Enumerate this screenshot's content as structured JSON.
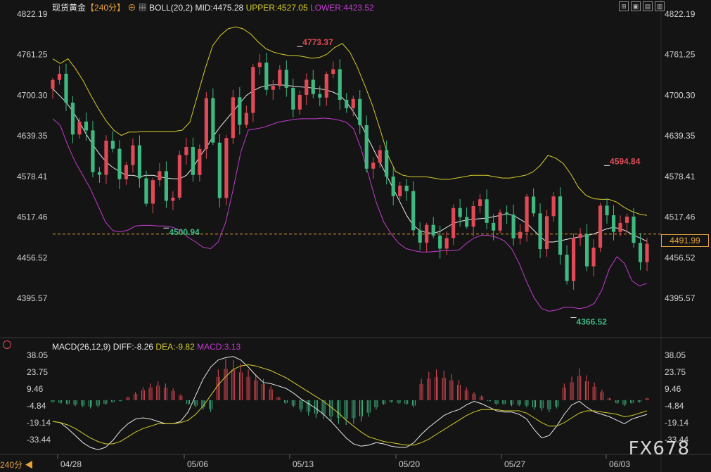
{
  "header": {
    "symbol": "现货黄金",
    "period": "【240分】",
    "indicator_icon": "boll-icon",
    "boll_label": "BOLL(20,2)",
    "mid_label": "MID:4475.28",
    "upper_label": "UPPER:4527.05",
    "lower_label": "LOWER:4423.52"
  },
  "toolbar": [
    "⊞",
    "▣",
    "▤",
    "▥"
  ],
  "macd_header": {
    "label": "MACD(26,12,9)",
    "diff_label": "DIFF:-8.26",
    "dea_label": "DEA:-9.82",
    "macd_label": "MACD:3.13"
  },
  "ticker_label": "240分",
  "current_price": "4491.99",
  "watermark": "FX678",
  "colors": {
    "background": "#141414",
    "up": "#e04a56",
    "down": "#3fb982",
    "mid": "#e8e8e8",
    "upper": "#d4cc2a",
    "lower": "#c23bd0",
    "price_line": "#e6a23c"
  },
  "chart_data": [
    {
      "type": "candlestick",
      "title": "现货黄金 240分",
      "y_ticks": [
        "4822.19",
        "4761.25",
        "4700.30",
        "4639.35",
        "4578.41",
        "4517.46",
        "4456.52",
        "4395.57"
      ],
      "ylim": [
        4360,
        4830
      ],
      "x_ticks": [
        "04/28",
        "05/06",
        "05/13",
        "05/20",
        "05/27",
        "06/03"
      ],
      "annotations": [
        {
          "label": "4773.37",
          "bar": 37,
          "price": 4773.37,
          "kind": "high"
        },
        {
          "label": "4500.94",
          "bar": 17,
          "price": 4500.94,
          "kind": "low"
        },
        {
          "label": "4594.84",
          "bar": 83,
          "price": 4594.84,
          "kind": "high"
        },
        {
          "label": "4366.52",
          "bar": 78,
          "price": 4366.52,
          "kind": "low"
        }
      ],
      "series": [
        {
          "name": "MID",
          "values": [
            4710,
            4700,
            4690,
            4676,
            4660,
            4642,
            4626,
            4612,
            4600,
            4592,
            4586,
            4580,
            4580,
            4578,
            4580,
            4580,
            4578,
            4576,
            4575,
            4575,
            4580,
            4592,
            4608,
            4622,
            4638,
            4652,
            4664,
            4676,
            4688,
            4700,
            4707,
            4712,
            4715,
            4716,
            4716,
            4715,
            4714,
            4713,
            4712,
            4711,
            4710,
            4708,
            4705,
            4700,
            4690,
            4676,
            4660,
            4640,
            4620,
            4600,
            4580,
            4560,
            4540,
            4520,
            4505,
            4497,
            4494,
            4493,
            4496,
            4502,
            4508,
            4511,
            4513,
            4514,
            4515,
            4516,
            4518,
            4520,
            4522,
            4520,
            4514,
            4508,
            4498,
            4488,
            4480,
            4480,
            4482,
            4484,
            4486,
            4488,
            4490,
            4492,
            4496,
            4500,
            4502,
            4500,
            4496,
            4490,
            4486,
            4481
          ]
        },
        {
          "name": "UPPER",
          "values": [
            4755,
            4748,
            4755,
            4740,
            4722,
            4700,
            4680,
            4662,
            4648,
            4640,
            4645,
            4645,
            4646,
            4646,
            4646,
            4646,
            4646,
            4648,
            4660,
            4700,
            4740,
            4775,
            4790,
            4800,
            4803,
            4800,
            4792,
            4780,
            4770,
            4765,
            4762,
            4760,
            4760,
            4758,
            4756,
            4757,
            4762,
            4772,
            4778,
            4765,
            4742,
            4714,
            4684,
            4648,
            4610,
            4586,
            4580,
            4578,
            4578,
            4578,
            4576,
            4574,
            4574,
            4576,
            4578,
            4580,
            4580,
            4580,
            4578,
            4576,
            4576,
            4578,
            4580,
            4585,
            4595,
            4610,
            4606,
            4598,
            4582,
            4562,
            4550,
            4545,
            4544,
            4544,
            4540,
            4532,
            4526,
            4522,
            4520
          ]
        },
        {
          "name": "LOWER",
          "values": [
            4665,
            4655,
            4625,
            4600,
            4580,
            4560,
            4535,
            4510,
            4497,
            4495,
            4498,
            4504,
            4505,
            4505,
            4504,
            4504,
            4502,
            4497,
            4487,
            4480,
            4472,
            4470,
            4480,
            4510,
            4560,
            4615,
            4648,
            4650,
            4652,
            4656,
            4660,
            4662,
            4664,
            4665,
            4665,
            4665,
            4666,
            4665,
            4663,
            4660,
            4650,
            4620,
            4580,
            4540,
            4510,
            4492,
            4478,
            4470,
            4467,
            4465,
            4465,
            4466,
            4467,
            4467,
            4468,
            4478,
            4486,
            4490,
            4490,
            4487,
            4482,
            4470,
            4448,
            4420,
            4396,
            4380,
            4376,
            4378,
            4382,
            4382,
            4380,
            4382,
            4388,
            4408,
            4440,
            4458,
            4448,
            4422,
            4414,
            4418
          ]
        }
      ],
      "current_price": 4491.99
    },
    {
      "type": "macd",
      "title": "MACD(26,12,9)",
      "y_ticks": [
        "38.05",
        "23.75",
        "9.46",
        "-4.84",
        "-19.14",
        "-33.44"
      ],
      "ylim": [
        -42,
        42
      ],
      "series": [
        {
          "name": "DIFF",
          "values": [
            -18,
            -19,
            -24,
            -30,
            -36,
            -40,
            -42,
            -40,
            -34,
            -26,
            -20,
            -16,
            -15,
            -16,
            -18,
            -20,
            -20,
            -18,
            -10,
            4,
            18,
            28,
            34,
            36,
            37,
            34,
            28,
            21,
            15,
            14,
            12,
            10,
            6,
            1,
            -3,
            -7,
            -12,
            -18,
            -25,
            -32,
            -37,
            -39,
            -38,
            -36,
            -37,
            -39,
            -40,
            -40,
            -36,
            -29,
            -23,
            -18,
            -13,
            -10,
            -8,
            -4,
            -1,
            -3,
            -6,
            -9,
            -10,
            -10,
            -12,
            -16,
            -25,
            -32,
            -30,
            -22,
            -12,
            -4,
            -1,
            -6,
            -10,
            -12,
            -14,
            -17,
            -20,
            -16,
            -14,
            -12
          ]
        },
        {
          "name": "DEA",
          "values": [
            -18,
            -19,
            -21,
            -24,
            -28,
            -32,
            -35,
            -37,
            -37,
            -35,
            -31,
            -27,
            -24,
            -22,
            -20,
            -20,
            -20,
            -19,
            -17,
            -12,
            -5,
            4,
            13,
            20,
            26,
            29,
            30,
            29,
            27,
            25,
            22,
            19,
            15,
            11,
            7,
            3,
            -1,
            -6,
            -11,
            -17,
            -22,
            -27,
            -31,
            -33,
            -35,
            -36,
            -37,
            -38,
            -38,
            -36,
            -33,
            -29,
            -25,
            -21,
            -17,
            -13,
            -10,
            -8,
            -8,
            -8,
            -9,
            -9,
            -9,
            -11,
            -15,
            -19,
            -22,
            -22,
            -19,
            -15,
            -11,
            -9,
            -9,
            -10,
            -11,
            -12,
            -14,
            -13,
            -11,
            -9
          ]
        },
        {
          "name": "MACD",
          "values": [
            -2,
            -3,
            -4,
            -5,
            -6,
            -7,
            -6,
            -4,
            -2,
            -1,
            3,
            7,
            11,
            14,
            16,
            14,
            10,
            5,
            -4,
            -6,
            -8,
            -10,
            26,
            35,
            34,
            31,
            26,
            22,
            18,
            12,
            3,
            -3,
            -6,
            -10,
            -13,
            -15,
            -16,
            -18,
            -20,
            -21,
            -20,
            -18,
            -14,
            -8,
            -4,
            -2,
            -3,
            -4,
            -6,
            18,
            24,
            26,
            25,
            22,
            17,
            11,
            7,
            4,
            -1,
            -4,
            -4,
            -5,
            -5,
            -6,
            -8,
            -9,
            -10,
            -7,
            14,
            20,
            27,
            21,
            15,
            9,
            2,
            -3,
            -5,
            -3,
            -2,
            2
          ]
        }
      ]
    }
  ]
}
